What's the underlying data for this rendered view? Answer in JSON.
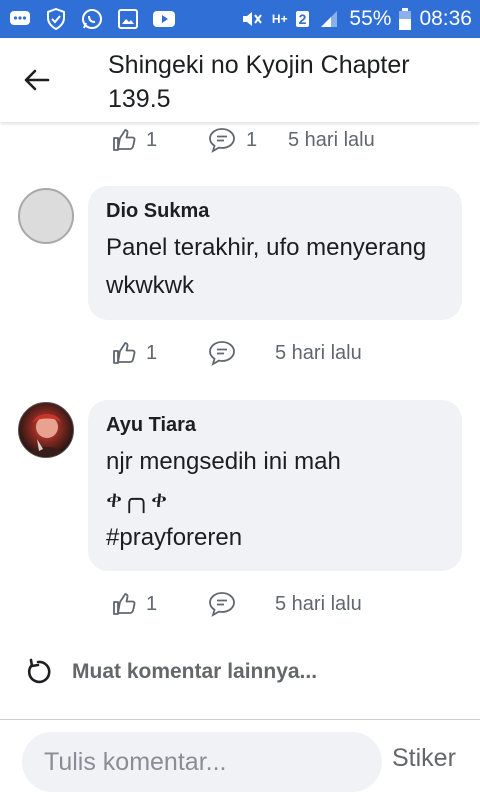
{
  "status_bar": {
    "battery": "55%",
    "time": "08:36",
    "network": "H+",
    "sim": "2",
    "icons": [
      "messages-icon",
      "shield-icon",
      "whatsapp-icon",
      "gallery-icon",
      "youtube-icon",
      "mute-icon",
      "signal-icon",
      "battery-icon"
    ]
  },
  "header": {
    "title": "Shingeki no Kyojin Chapter 139.5",
    "back_icon": "arrow-left-icon"
  },
  "comments": [
    {
      "author": "",
      "text": "",
      "likes": "1",
      "replies": "1",
      "time": "5 hari lalu"
    },
    {
      "author": "Dio Sukma",
      "text": "Panel terakhir, ufo menyerang wkwkwk",
      "likes": "1",
      "replies": "",
      "time": "5 hari lalu"
    },
    {
      "author": "Ayu Tiara",
      "text_lines": [
        "njr mengsedih ini mah",
        "ቀ╭╮ቀ",
        "#prayforeren"
      ],
      "likes": "1",
      "replies": "",
      "time": "5 hari lalu"
    }
  ],
  "load_more": {
    "label": "Muat komentar lainnya...",
    "icon": "refresh-icon"
  },
  "composer": {
    "placeholder": "Tulis komentar...",
    "value": "",
    "sticker_label": "Stiker"
  },
  "colors": {
    "status_bar": "#2f6fd6",
    "bubble": "#f0f2f5",
    "meta_text": "#606770"
  }
}
